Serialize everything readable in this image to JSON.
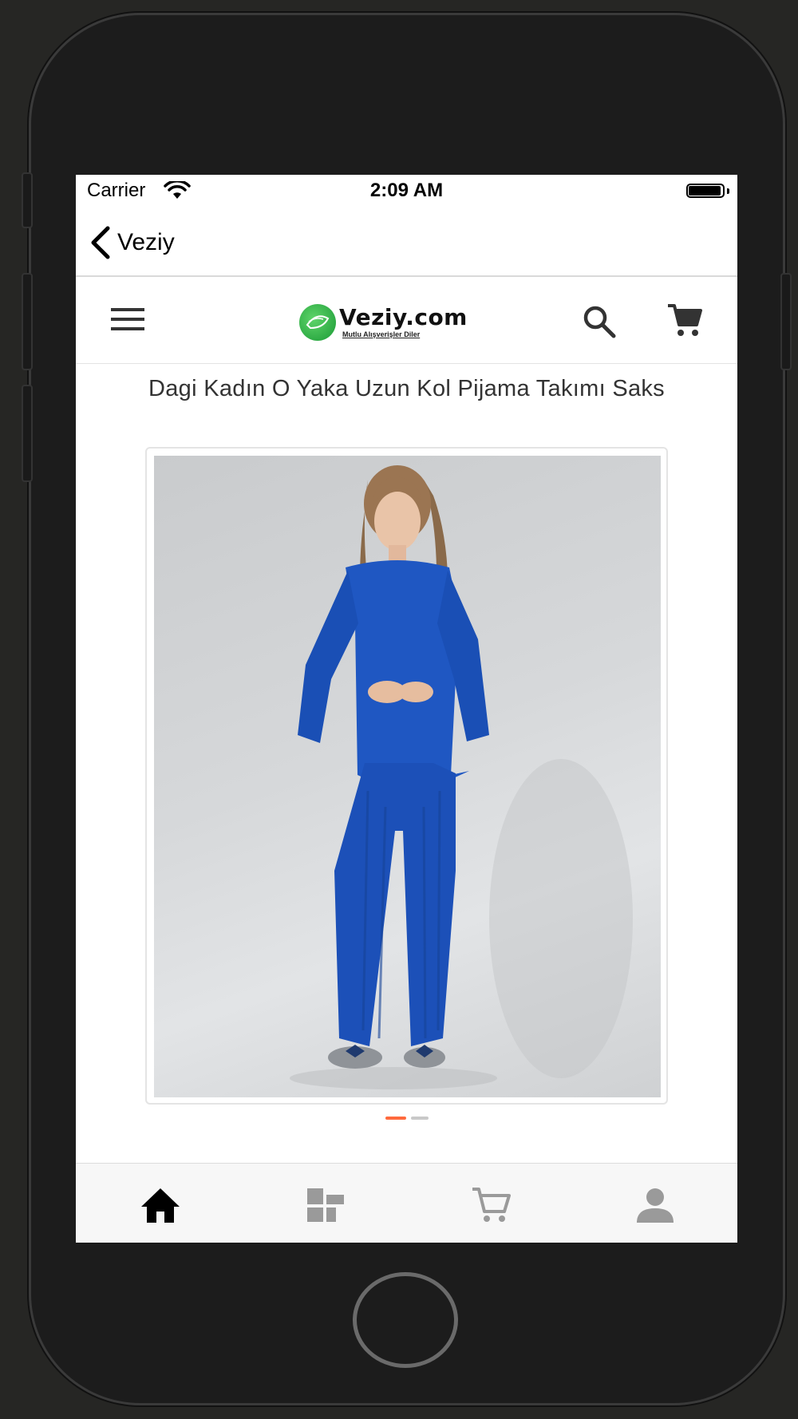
{
  "status_bar": {
    "carrier": "Carrier",
    "time": "2:09 AM"
  },
  "nav": {
    "back_label": "Veziy"
  },
  "header": {
    "logo_name": "Veziy.com",
    "logo_tagline": "Mutlu Alışverişler Diler"
  },
  "product": {
    "title": "Dagi Kadın O Yaka Uzun Kol Pijama Takımı Saks",
    "image_index": 1,
    "image_count": 2
  },
  "tabs": [
    {
      "name": "home",
      "icon": "home-icon",
      "active": true
    },
    {
      "name": "categories",
      "icon": "categories-icon",
      "active": false
    },
    {
      "name": "cart",
      "icon": "cart-icon",
      "active": false
    },
    {
      "name": "profile",
      "icon": "profile-icon",
      "active": false
    }
  ],
  "colors": {
    "accent": "#ff6a3d",
    "active_tab": "#000000",
    "inactive_tab": "#9a9a9a",
    "product_blue": "#1f57c2"
  }
}
